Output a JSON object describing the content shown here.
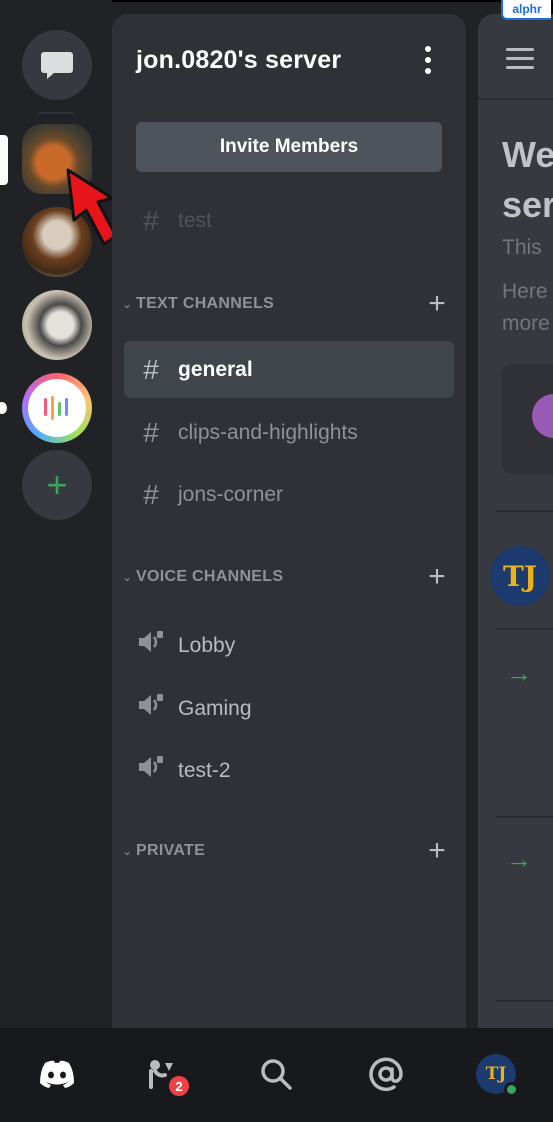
{
  "watermark": "alphr",
  "rail": {
    "servers": [
      "garfield-server",
      "dachshund-server",
      "dog-server",
      "streaming-server"
    ]
  },
  "panel": {
    "server_name": "jon.0820's server",
    "invite_label": "Invite Members",
    "muted_channel": "test",
    "categories": [
      {
        "title": "TEXT CHANNELS"
      },
      {
        "title": "VOICE CHANNELS"
      },
      {
        "title": "PRIVATE"
      }
    ],
    "text_channels": [
      "general",
      "clips-and-highlights",
      "jons-corner"
    ],
    "selected_channel": "general",
    "voice_channels": [
      "Lobby",
      "Gaming",
      "test-2"
    ]
  },
  "chat": {
    "welcome_lines": [
      "We",
      "ser"
    ],
    "sub_lines": [
      "This",
      "Here",
      "more"
    ],
    "avatar_initials": "TJ",
    "arrow": "→"
  },
  "bottom": {
    "friends_badge": "2",
    "profile_initials": "TJ"
  },
  "colors": {
    "accent_green": "#3ba55d",
    "badge_red": "#ed4245",
    "panel_bg": "#2f3136",
    "rail_bg": "#202225"
  }
}
